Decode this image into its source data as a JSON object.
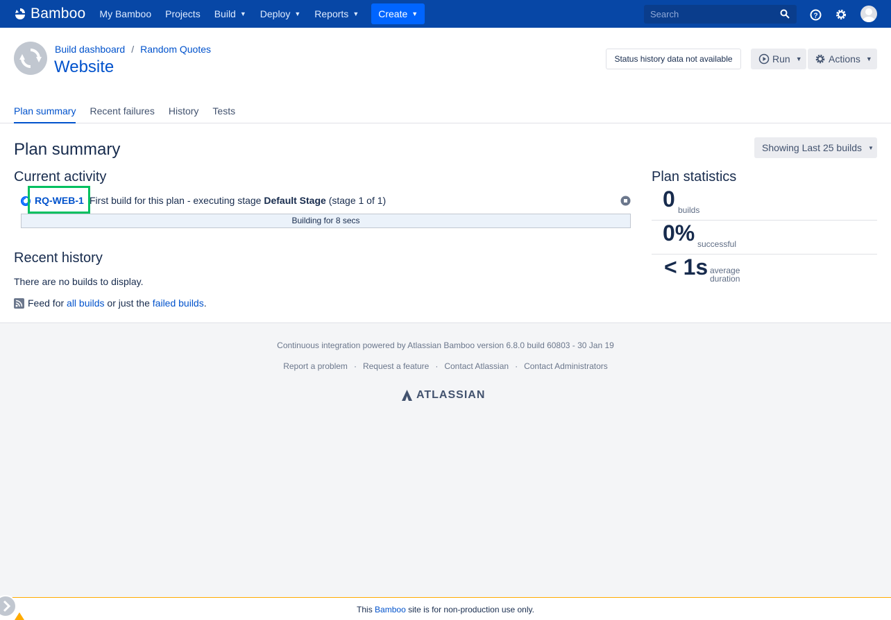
{
  "nav": {
    "brand": "Bamboo",
    "items": [
      {
        "label": "My Bamboo"
      },
      {
        "label": "Projects"
      },
      {
        "label": "Build"
      },
      {
        "label": "Deploy"
      },
      {
        "label": "Reports"
      }
    ],
    "create_label": "Create",
    "search_placeholder": "Search"
  },
  "header": {
    "breadcrumb": [
      "Build dashboard",
      "Random Quotes"
    ],
    "breadcrumb_sep": "/",
    "title": "Website",
    "status_history": "Status history data not available",
    "run_label": "Run",
    "actions_label": "Actions",
    "tabs": [
      "Plan summary",
      "Recent failures",
      "History",
      "Tests"
    ]
  },
  "main": {
    "heading": "Plan summary",
    "showing": "Showing Last 25 builds",
    "current_activity": "Current activity",
    "build_key": "RQ-WEB-1",
    "activity_pre": "First build for this plan - executing stage ",
    "activity_stage": "Default Stage",
    "activity_post": " (stage 1 of 1)",
    "progress_text": "Building for 8 secs",
    "recent_history": "Recent history",
    "no_builds": "There are no builds to display.",
    "feed_pre": "Feed for ",
    "feed_all": "all builds",
    "feed_mid": " or just the ",
    "feed_failed": "failed builds",
    "feed_end": "."
  },
  "stats": {
    "heading": "Plan statistics",
    "builds_num": "0",
    "builds_label": "builds",
    "success_num": "0%",
    "success_label": "successful",
    "duration_num": "< 1s",
    "duration_label_1": "average",
    "duration_label_2": "duration"
  },
  "footer": {
    "powered": "Continuous integration powered by Atlassian Bamboo version 6.8.0 build 60803 - 30 Jan 19",
    "links": [
      "Report a problem",
      "Request a feature",
      "Contact Atlassian",
      "Contact Administrators"
    ],
    "link_sep": "·",
    "atlassian": "ATLASSIAN"
  },
  "banner": {
    "pre": "This ",
    "link": "Bamboo",
    "post": " site is for non-production use only."
  },
  "colors": {
    "nav_bg": "#0747a6",
    "link": "#0052cc",
    "highlight": "#00c060"
  },
  "icons": [
    "bamboo-logo-icon",
    "chevron-down-icon",
    "search-icon",
    "help-icon",
    "gear-icon",
    "avatar-icon",
    "plan-refresh-icon",
    "play-icon",
    "building-icon",
    "stop-icon",
    "rss-feed-icon",
    "atlassian-logo-icon",
    "warning-icon"
  ]
}
